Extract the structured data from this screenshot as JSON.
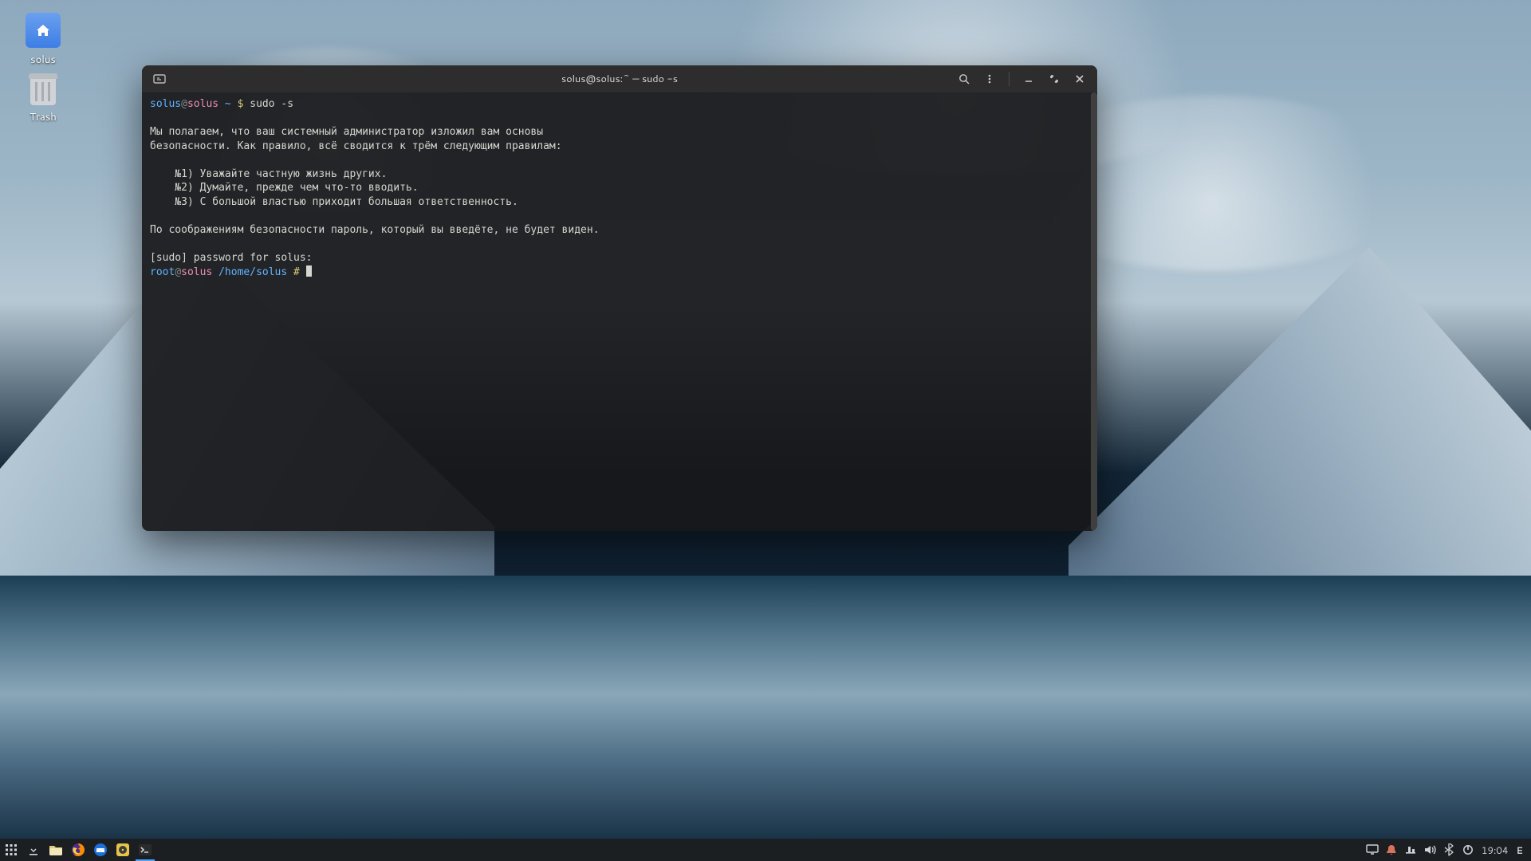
{
  "desktop_icons": [
    {
      "label": "solus",
      "kind": "home"
    },
    {
      "label": "Trash",
      "kind": "trash"
    }
  ],
  "window": {
    "title": "solus@solus:~ — sudo -s",
    "prompt1_user": "solus",
    "prompt1_at": "@",
    "prompt1_host": "solus",
    "prompt1_path": " ~ ",
    "prompt1_sym": "$ ",
    "prompt1_cmd": "sudo -s",
    "body_line1": "Мы полагаем, что ваш системный администратор изложил вам основы",
    "body_line2": "безопасности. Как правило, всё сводится к трём следующим правилам:",
    "rule1": "    №1) Уважайте частную жизнь других.",
    "rule2": "    №2) Думайте, прежде чем что-то вводить.",
    "rule3": "    №3) С большой властью приходит большая ответственность.",
    "body_line3": "По соображениям безопасности пароль, который вы введёте, не будет виден.",
    "pwd_prompt": "[sudo] password for solus: ",
    "prompt2_user": "root",
    "prompt2_at": "@",
    "prompt2_host": "solus",
    "prompt2_path": " /home/solus ",
    "prompt2_sym": "# "
  },
  "panel": {
    "clock": "19:04",
    "keyboard": "E"
  }
}
